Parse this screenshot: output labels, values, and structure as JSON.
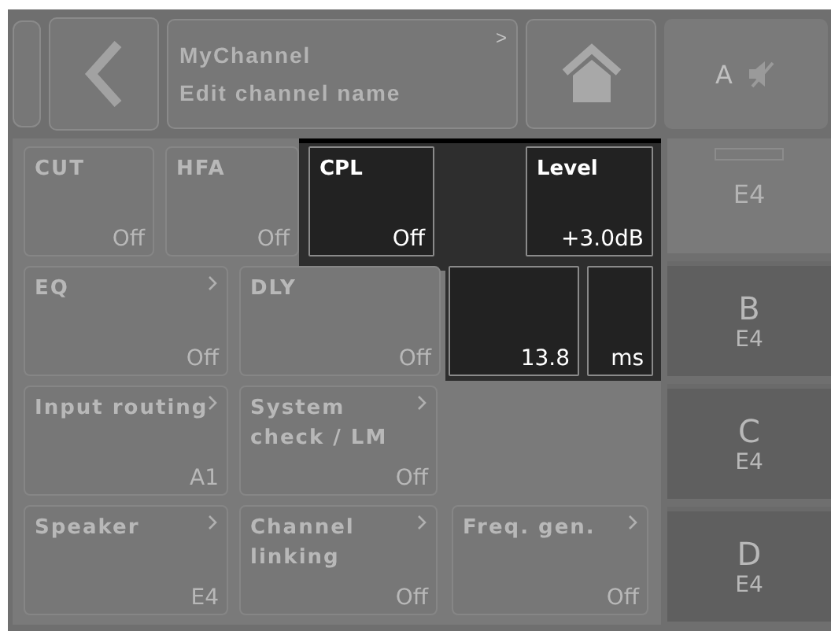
{
  "header": {
    "channel_name": "MyChannel",
    "hint": "Edit channel name",
    "arrow": ">",
    "status_channel": "A",
    "muted": true
  },
  "rows": [
    {
      "tiles": [
        {
          "label": "CUT",
          "value": "Off",
          "arrow": false,
          "active": false
        },
        {
          "label": "HFA",
          "value": "Off",
          "arrow": false,
          "active": false
        },
        {
          "label": "CPL",
          "value": "Off",
          "arrow": false,
          "active": true
        },
        {
          "label": "Level",
          "value": "+3.0dB",
          "arrow": false,
          "active": true
        }
      ]
    },
    {
      "tiles": [
        {
          "label": "EQ",
          "value": "Off",
          "arrow": true,
          "active": false
        },
        {
          "label": "DLY",
          "value": "Off",
          "arrow": false,
          "active": false
        },
        {
          "value": "13.8",
          "arrow": false,
          "active": true
        },
        {
          "value": "ms",
          "arrow": false,
          "active": true
        }
      ]
    },
    {
      "tiles": [
        {
          "label": "Input routing",
          "value": "A1",
          "arrow": true,
          "active": false
        },
        {
          "label": "System check / LM",
          "value": "Off",
          "arrow": true,
          "active": false
        }
      ]
    },
    {
      "tiles": [
        {
          "label": "Speaker",
          "value": "E4",
          "arrow": true,
          "active": false
        },
        {
          "label": "Channel linking",
          "value": "Off",
          "arrow": true,
          "active": false
        },
        {
          "label": "Freq. gen.",
          "value": "Off",
          "arrow": true,
          "active": false
        }
      ]
    }
  ],
  "channels": [
    {
      "value": "E4",
      "selected": true
    },
    {
      "letter": "B",
      "value": "E4",
      "selected": false
    },
    {
      "letter": "C",
      "value": "E4",
      "selected": false
    },
    {
      "letter": "D",
      "value": "E4",
      "selected": false
    }
  ]
}
